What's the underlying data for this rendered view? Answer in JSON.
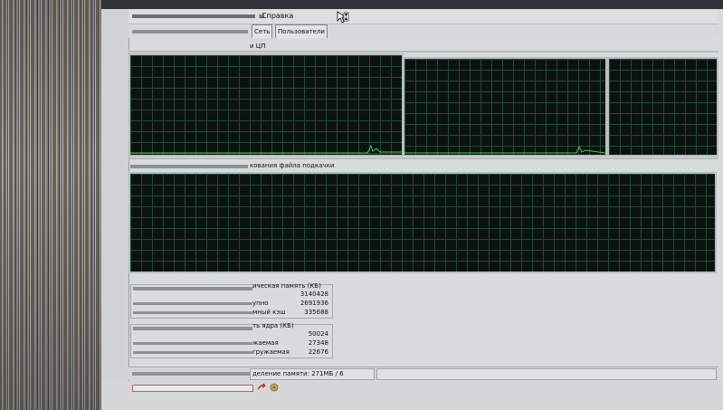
{
  "menu": {
    "help": "Справка",
    "partial_left": "ы"
  },
  "tabs": [
    {
      "label": "Сеть"
    },
    {
      "label": "Пользователи"
    }
  ],
  "cpu_section": {
    "label": "и ЦП"
  },
  "pagefile_section": {
    "label": "кования файла подкачки"
  },
  "physical_memory": {
    "title": "ическая память (КБ)",
    "rows": [
      {
        "label": "",
        "value": "3140428"
      },
      {
        "label": "упно",
        "value": "2691936"
      },
      {
        "label": "мный кэш",
        "value": "335688"
      }
    ]
  },
  "kernel_memory": {
    "title": "ть ядра (КБ)",
    "rows": [
      {
        "label": "",
        "value": "50024"
      },
      {
        "label": "жаемая",
        "value": "27348"
      },
      {
        "label": "гружаемая",
        "value": "22676"
      }
    ]
  },
  "status": {
    "commit_text": "деление памяти: 271МБ / 6"
  },
  "colors": {
    "graph_green": "#3fcf5a",
    "graph_bg": "#0c120f"
  },
  "icons": [
    "hourglass-cursor-icon",
    "taskbar-arrow-icon",
    "taskbar-globe-icon"
  ]
}
